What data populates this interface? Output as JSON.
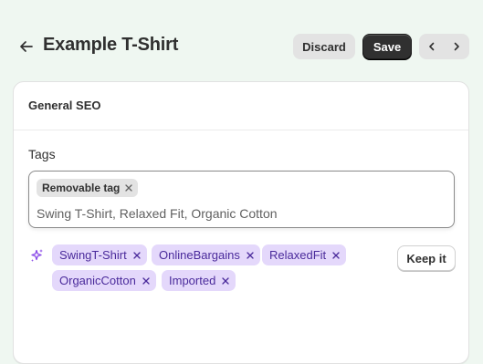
{
  "page": {
    "title": "Example T-Shirt",
    "discard_label": "Discard",
    "save_label": "Save"
  },
  "colors": {
    "background": "#eff7f1",
    "primary_button": "#303030",
    "suggestion_chip_bg": "#e4d8fb",
    "suggestion_chip_text": "#4a2a9b",
    "ai_accent": "#8a4be8"
  },
  "icons": {
    "back": "arrow-left-icon",
    "previous": "chevron-left-icon",
    "next": "chevron-right-icon",
    "remove": "x-icon",
    "ai": "sparkle-icon"
  },
  "seo_card": {
    "title": "General SEO",
    "tags_label": "Tags",
    "existing_tags": [
      "Removable tag"
    ],
    "input_placeholder": "Swing T-Shirt, Relaxed Fit, Organic Cotton",
    "suggested_tags": [
      "SwingT-Shirt",
      "OnlineBargains",
      "RelaxedFit",
      "OrganicCotton",
      "Imported"
    ],
    "keep_label": "Keep it"
  }
}
